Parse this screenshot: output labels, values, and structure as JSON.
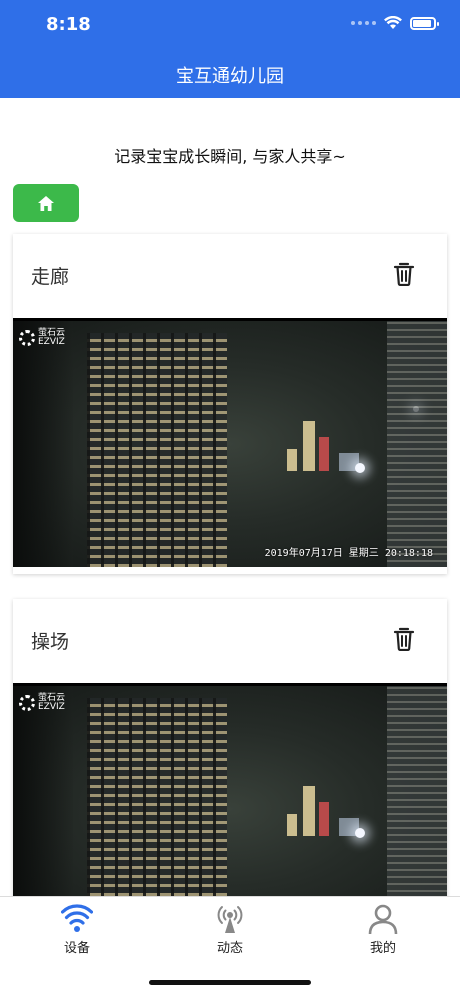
{
  "status_bar": {
    "time": "8:18",
    "battery_level": 0.9
  },
  "header": {
    "title": "宝互通幼儿园"
  },
  "tagline": "记录宝宝成长瞬间, 与家人共享~",
  "home_button": {
    "icon": "home-icon"
  },
  "cameras": [
    {
      "name": "走廊",
      "delete_icon": "trash-icon",
      "logo_line1": "萤石云",
      "logo_line2": "EZVIZ",
      "timestamp": "2019年07月17日 星期三 20:18:18"
    },
    {
      "name": "操场",
      "delete_icon": "trash-icon",
      "logo_line1": "萤石云",
      "logo_line2": "EZVIZ"
    }
  ],
  "tabbar": {
    "items": [
      {
        "label": "设备",
        "icon": "wifi-signal-icon",
        "active": true,
        "color": "#2f6fe8"
      },
      {
        "label": "动态",
        "icon": "broadcast-tower-icon",
        "active": false,
        "color": "#888888"
      },
      {
        "label": "我的",
        "icon": "person-icon",
        "active": false,
        "color": "#888888"
      }
    ]
  },
  "colors": {
    "header_bg": "#2f6fe8",
    "home_button_bg": "#3cb94a"
  }
}
